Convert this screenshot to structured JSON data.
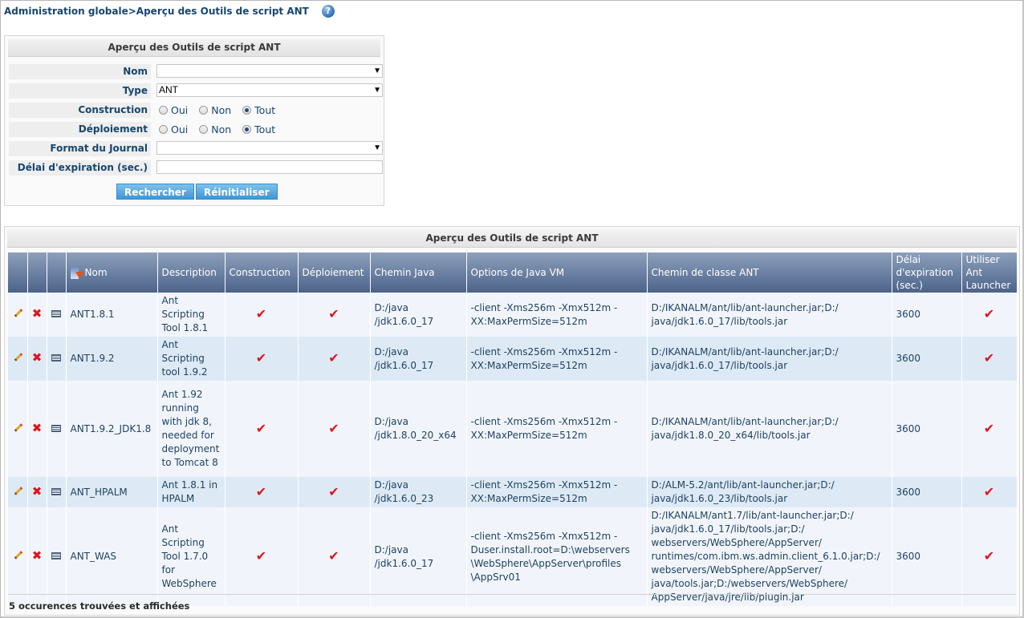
{
  "breadcrumb": {
    "text": "Administration globale>Aperçu des Outils de script ANT",
    "help_icon": "?"
  },
  "search_panel": {
    "title": "Aperçu des Outils de script ANT",
    "fields": {
      "nom": {
        "label": "Nom",
        "value": ""
      },
      "type": {
        "label": "Type",
        "value": "ANT"
      },
      "construction": {
        "label": "Construction",
        "options": [
          "Oui",
          "Non",
          "Tout"
        ],
        "selected": "Tout"
      },
      "deploiement": {
        "label": "Déploiement",
        "options": [
          "Oui",
          "Non",
          "Tout"
        ],
        "selected": "Tout"
      },
      "format_journal": {
        "label": "Format du Journal",
        "value": ""
      },
      "delai": {
        "label": "Délai d'expiration (sec.)",
        "value": ""
      }
    },
    "search_button": "Rechercher",
    "reset_button": "Réinitialiser"
  },
  "results": {
    "title": "Aperçu des Outils de script ANT",
    "columns": [
      "Nom",
      "Description",
      "Construction",
      "Déploiement",
      "Chemin Java",
      "Options de Java VM",
      "Chemin de classe ANT",
      "Délai d'expiration (sec.)",
      "Utiliser Ant Launcher"
    ],
    "rows": [
      {
        "nom": "ANT1.8.1",
        "description": "Ant Scripting Tool 1.8.1",
        "construction": "✔",
        "deploiement": "✔",
        "chemin_java": "D:/java /jdk1.6.0_17",
        "options_vm": "-client -Xms256m -Xmx512m -XX:MaxPermSize=512m",
        "classpath": "D:/IKANALM/ant/lib/ant-launcher.jar;D:/ java/jdk1.6.0_17/lib/tools.jar",
        "delai": "3600",
        "launcher": "✔"
      },
      {
        "nom": "ANT1.9.2",
        "description": "Ant Scripting tool 1.9.2",
        "construction": "✔",
        "deploiement": "✔",
        "chemin_java": "D:/java /jdk1.6.0_17",
        "options_vm": "-client -Xms256m -Xmx512m -XX:MaxPermSize=512m",
        "classpath": "D:/IKANALM/ant/lib/ant-launcher.jar;D:/ java/jdk1.6.0_17/lib/tools.jar",
        "delai": "3600",
        "launcher": "✔"
      },
      {
        "nom": "ANT1.9.2_JDK1.8",
        "description": "Ant 1.92 running with jdk 8, needed for deployment to Tomcat 8",
        "construction": "✔",
        "deploiement": "✔",
        "chemin_java": "D:/java /jdk1.8.0_20_x64",
        "options_vm": "-client -Xms256m -Xmx512m -XX:MaxPermSize=512m",
        "classpath": "D:/IKANALM/ant/lib/ant-launcher.jar;D:/ java/jdk1.8.0_20_x64/lib/tools.jar",
        "delai": "3600",
        "launcher": "✔"
      },
      {
        "nom": "ANT_HPALM",
        "description": "Ant 1.8.1 in HPALM",
        "construction": "✔",
        "deploiement": "✔",
        "chemin_java": "D:/java /jdk1.6.0_23",
        "options_vm": "-client -Xms256m -Xmx512m -XX:MaxPermSize=512m",
        "classpath": "D:/ALM-5.2/ant/lib/ant-launcher.jar;D:/ java/jdk1.6.0_23/lib/tools.jar",
        "delai": "3600",
        "launcher": "✔"
      },
      {
        "nom": "ANT_WAS",
        "description": "Ant Scripting Tool 1.7.0 for WebSphere",
        "construction": "✔",
        "deploiement": "✔",
        "chemin_java": "D:/java /jdk1.6.0_17",
        "options_vm": "-client -Xms256m -Xmx512m -Duser.install.root=D:\\webservers \\WebSphere\\AppServer\\profiles \\AppSrv01",
        "classpath": "D:/IKANALM/ant1.7/lib/ant-launcher.jar;D:/ java/jdk1.6.0_17/lib/tools.jar;D:/ webservers/WebSphere/AppServer/ runtimes/com.ibm.ws.admin.client_6.1.0.jar;D:/ webservers/WebSphere/AppServer/ java/tools.jar;D:/webservers/WebSphere/ AppServer/java/jre/lib/plugin.jar",
        "delai": "3600",
        "launcher": "✔"
      }
    ],
    "footer": "5 occurences trouvées et affichées"
  }
}
